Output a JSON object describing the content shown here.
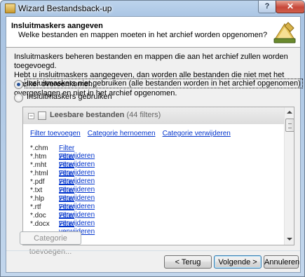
{
  "window": {
    "title": "Wizard Bestandsback-up",
    "help_glyph": "?",
    "close_glyph": "✕"
  },
  "header": {
    "title": "Insluitmaskers aangeven",
    "subtitle": "Welke bestanden en mappen moeten in het archief worden opgenomen?"
  },
  "description": {
    "line1": "Insluitmaskers beheren bestanden en mappen die aan het archief zullen worden toegevoegd.",
    "line2": "Hebt u insluitmaskers aangegeven, dan worden alle bestanden die niet met het masker overeenkomen,",
    "line3": "overgeslagen en niet in het archief opgenomen."
  },
  "options": {
    "no_masks": "Insluitmaskers niet gebruiken (alle bestanden worden in het archief opgenomen)",
    "use_masks": "Insluitmaskers gebruiken",
    "selected": "no_masks"
  },
  "filter_group": {
    "collapse_glyph": "−",
    "title": "Leesbare bestanden",
    "count": "(44 filters)",
    "actions": [
      "Filter toevoegen",
      "Categorie hernoemen",
      "Categorie verwijderen"
    ],
    "remove_label": "Filter verwijderen",
    "filters": [
      "*.chm",
      "*.htm",
      "*.mht",
      "*.html",
      "*.pdf",
      "*.txt",
      "*.hlp",
      "*.rtf",
      "*.doc",
      "*.docx"
    ]
  },
  "buttons": {
    "add_category": "Categorie toevoegen...",
    "back": "< Terug",
    "next": "Volgende >",
    "cancel": "Annuleren"
  },
  "colors": {
    "link": "#0033cc",
    "title_bar": "#a9c4e3",
    "close_button": "#c7473a"
  },
  "icons": {
    "app": "backup-icon",
    "header": "archive-icon"
  }
}
